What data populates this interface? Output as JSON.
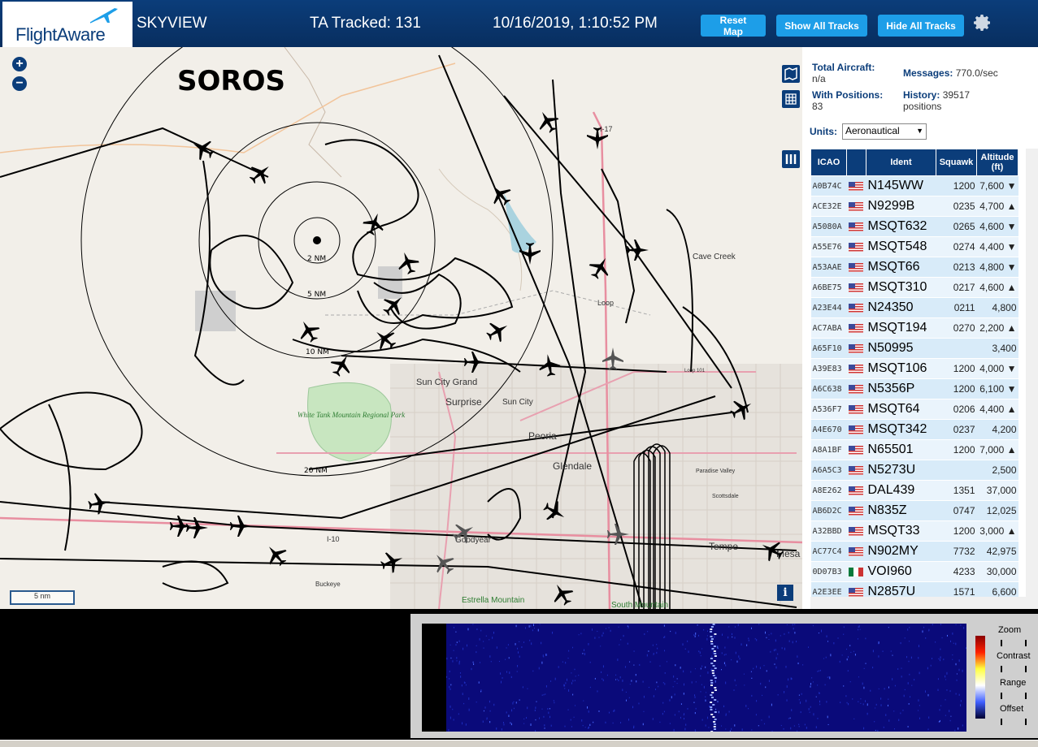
{
  "header": {
    "logo_text": "FlightAware",
    "site_name": "SKYVIEW",
    "tracked_label": "TA Tracked: 131",
    "datetime": "10/16/2019, 1:10:52 PM",
    "buttons": {
      "reset": "Reset Map",
      "show_all": "Show All Tracks",
      "hide_all": "Hide All Tracks"
    }
  },
  "map": {
    "overlay_title": "SOROS",
    "ring_labels": [
      "2 NM",
      "5 NM",
      "10 NM",
      "20 NM"
    ],
    "place_labels": [
      "Cave Creek",
      "Sun City Grand",
      "Surprise",
      "Sun City",
      "Peoria",
      "Glendale",
      "Goodyear",
      "Tempe",
      "Mesa",
      "Scottsdale",
      "Paradise Valley",
      "Buckeye",
      "Estrella Mountain",
      "South Mountain",
      "Loop 101",
      "Loop",
      "I-10",
      "I-17"
    ],
    "park_label": "White Tank Mountain Regional Park",
    "scale_label": "5 nm"
  },
  "panel": {
    "total_aircraft_label": "Total Aircraft:",
    "total_aircraft_value": "n/a",
    "with_positions_label": "With Positions:",
    "with_positions_value": "83",
    "messages_label": "Messages:",
    "messages_value": "770.0/sec",
    "history_label": "History:",
    "history_value": "39517 positions",
    "units_label": "Units:",
    "units_value": "Aeronautical",
    "table_headers": [
      "ICAO",
      "",
      "Ident",
      "Squawk",
      "Altitude (ft)"
    ],
    "rows": [
      {
        "icao": "A0B74C",
        "flag": "us",
        "ident": "N145WW",
        "squawk": "1200",
        "altitude": "7,600",
        "trend": "▼"
      },
      {
        "icao": "ACE32E",
        "flag": "us",
        "ident": "N9299B",
        "squawk": "0235",
        "altitude": "4,700",
        "trend": "▲"
      },
      {
        "icao": "A5080A",
        "flag": "us",
        "ident": "MSQT632",
        "squawk": "0265",
        "altitude": "4,600",
        "trend": "▼"
      },
      {
        "icao": "A55E76",
        "flag": "us",
        "ident": "MSQT548",
        "squawk": "0274",
        "altitude": "4,400",
        "trend": "▼"
      },
      {
        "icao": "A53AAE",
        "flag": "us",
        "ident": "MSQT66",
        "squawk": "0213",
        "altitude": "4,800",
        "trend": "▼"
      },
      {
        "icao": "A6BE75",
        "flag": "us",
        "ident": "MSQT310",
        "squawk": "0217",
        "altitude": "4,600",
        "trend": "▲"
      },
      {
        "icao": "A23E44",
        "flag": "us",
        "ident": "N24350",
        "squawk": "0211",
        "altitude": "4,800",
        "trend": ""
      },
      {
        "icao": "AC7ABA",
        "flag": "us",
        "ident": "MSQT194",
        "squawk": "0270",
        "altitude": "2,200",
        "trend": "▲"
      },
      {
        "icao": "A65F10",
        "flag": "us",
        "ident": "N50995",
        "squawk": "",
        "altitude": "3,400",
        "trend": ""
      },
      {
        "icao": "A39E83",
        "flag": "us",
        "ident": "MSQT106",
        "squawk": "1200",
        "altitude": "4,000",
        "trend": "▼"
      },
      {
        "icao": "A6C638",
        "flag": "us",
        "ident": "N5356P",
        "squawk": "1200",
        "altitude": "6,100",
        "trend": "▼"
      },
      {
        "icao": "A536F7",
        "flag": "us",
        "ident": "MSQT64",
        "squawk": "0206",
        "altitude": "4,400",
        "trend": "▲"
      },
      {
        "icao": "A4E670",
        "flag": "us",
        "ident": "MSQT342",
        "squawk": "0237",
        "altitude": "4,200",
        "trend": ""
      },
      {
        "icao": "A8A1BF",
        "flag": "us",
        "ident": "N65501",
        "squawk": "1200",
        "altitude": "7,000",
        "trend": "▲"
      },
      {
        "icao": "A6A5C3",
        "flag": "us",
        "ident": "N5273U",
        "squawk": "",
        "altitude": "2,500",
        "trend": ""
      },
      {
        "icao": "A8E262",
        "flag": "us",
        "ident": "DAL439",
        "squawk": "1351",
        "altitude": "37,000",
        "trend": ""
      },
      {
        "icao": "AB6D2C",
        "flag": "us",
        "ident": "N835Z",
        "squawk": "0747",
        "altitude": "12,025",
        "trend": ""
      },
      {
        "icao": "A32BBD",
        "flag": "us",
        "ident": "MSQT33",
        "squawk": "1200",
        "altitude": "3,000",
        "trend": "▲"
      },
      {
        "icao": "AC77C4",
        "flag": "us",
        "ident": "N902MY",
        "squawk": "7732",
        "altitude": "42,975",
        "trend": ""
      },
      {
        "icao": "0D07B3",
        "flag": "mx",
        "ident": "VOI960",
        "squawk": "4233",
        "altitude": "30,000",
        "trend": ""
      },
      {
        "icao": "A2E3EE",
        "flag": "us",
        "ident": "N2857U",
        "squawk": "1571",
        "altitude": "6,600",
        "trend": ""
      }
    ]
  },
  "spectrum": {
    "labels": {
      "zoom": "Zoom",
      "contrast": "Contrast",
      "range": "Range",
      "offset": "Offset"
    }
  },
  "colors": {
    "header_bg": "#0b3d7a",
    "button_bg": "#1d9ee8",
    "row_odd": "#d8ebf9",
    "row_even": "#eaf4fc",
    "map_bg": "#f2efe9"
  },
  "icons": [
    "flightaware-plane-icon",
    "gear-icon",
    "zoom-in-icon",
    "zoom-out-icon",
    "map-layers-icon",
    "grid-icon",
    "columns-icon",
    "info-icon",
    "airplane-icon"
  ]
}
